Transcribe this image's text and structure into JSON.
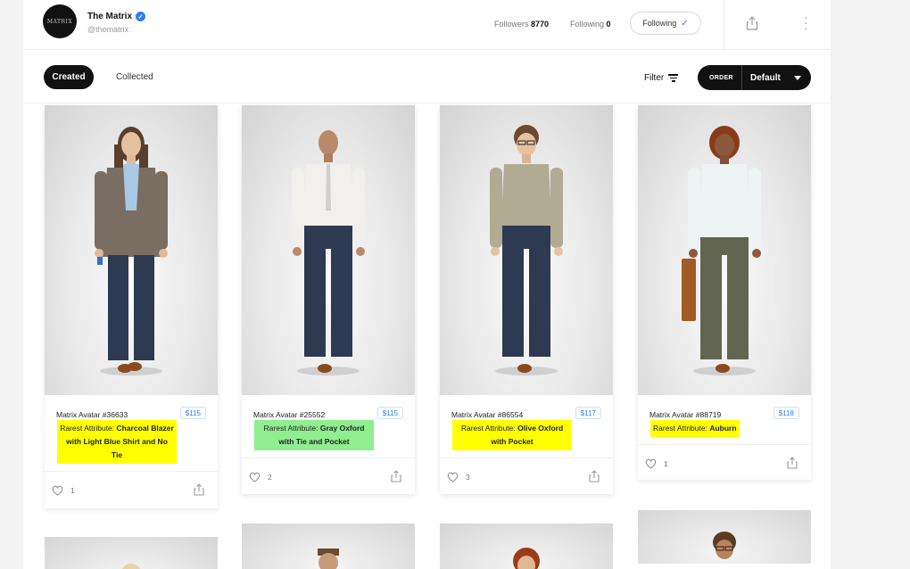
{
  "profile": {
    "name": "The Matrix",
    "handle": "@thematrix",
    "avatar_text": "MATRIX",
    "followers_label": "Followers",
    "followers_count": "8770",
    "following_label": "Following",
    "following_count": "0",
    "follow_button_label": "Following"
  },
  "tabs": {
    "created": "Created",
    "collected": "Collected"
  },
  "toolbar": {
    "filter_label": "Filter",
    "order_label": "ORDER",
    "order_value": "Default"
  },
  "colors": {
    "accent": "#2f80ed",
    "highlight_yellow": "#ffff00",
    "highlight_green": "#90ee90"
  },
  "cards": [
    {
      "title": "Matrix Avatar #36633",
      "price": "$115",
      "rarest_prefix": "Rarest Attribute:",
      "rarest_value": "Charcoal Blazer with Light Blue Shirt and No Tie",
      "likes": "1",
      "highlight": "#ffff00"
    },
    {
      "title": "Matrix Avatar #25552",
      "price": "$115",
      "rarest_prefix": "Rarest Attribute:",
      "rarest_value": "Gray Oxford with Tie and Pocket",
      "likes": "2",
      "highlight": "#90ee90"
    },
    {
      "title": "Matrix Avatar #86554",
      "price": "$117",
      "rarest_prefix": "Rarest Attribute:",
      "rarest_value": "Olive Oxford with Pocket",
      "likes": "3",
      "highlight": "#ffff00"
    },
    {
      "title": "Matrix Avatar #88719",
      "price": "$118",
      "rarest_prefix": "Rarest Attribute:",
      "rarest_value": "Auburn",
      "likes": "1",
      "highlight": "#ffff00"
    }
  ],
  "icons": {
    "verified": "verified-badge-icon",
    "share": "share-icon",
    "more": "more-icon",
    "filter": "filter-icon",
    "heart": "heart-icon",
    "check": "check-icon",
    "caret": "caret-down-icon"
  }
}
